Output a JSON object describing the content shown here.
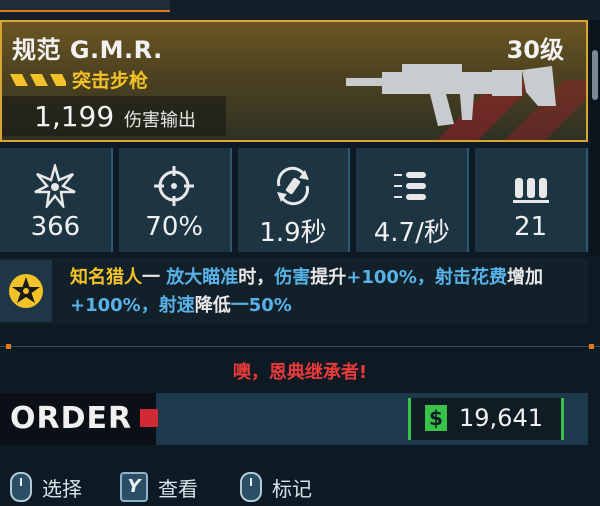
{
  "weapon": {
    "name": "规范 G.M.R.",
    "level": "30级",
    "type": "突击步枪",
    "dps_value": "1,199",
    "dps_label": "伤害输出"
  },
  "stats": [
    {
      "icon": "damage-burst-icon",
      "value": "366"
    },
    {
      "icon": "crosshair-icon",
      "value": "70%"
    },
    {
      "icon": "reload-icon",
      "value": "1.9秒"
    },
    {
      "icon": "fire-rate-icon",
      "value": "4.7/秒"
    },
    {
      "icon": "magazine-icon",
      "value": "21"
    }
  ],
  "perk": {
    "name": "知名猎人",
    "dash": "一 ",
    "part1": "放大瞄准",
    "part2": "时，",
    "part3": "伤害",
    "part4": "提升",
    "part5": "+100%，",
    "part6": "射击花费",
    "part7": "增加",
    "part8": "+100%，",
    "part9": "射速",
    "part10": "降低",
    "part11": "一50%"
  },
  "warning": "噢，恩典继承者!",
  "brand": "ORDER",
  "money": "19,641",
  "money_icon": "$",
  "controls": [
    {
      "key_icon": "mouse-left-icon",
      "label": "选择"
    },
    {
      "key": "Y",
      "label": "查看"
    },
    {
      "key_icon": "mouse-middle-icon",
      "label": "标记"
    }
  ],
  "colors": {
    "rarity_gold": "#d9a532",
    "type_yellow": "#f2c228",
    "highlight_blue": "#58b2e8",
    "warning_red": "#e83a3a",
    "money_green": "#38c24a"
  }
}
